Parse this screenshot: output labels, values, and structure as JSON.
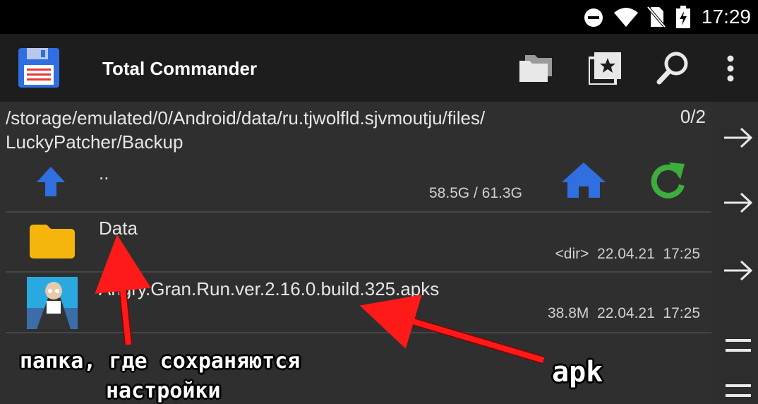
{
  "status_bar": {
    "time": "17:29",
    "icons": [
      "do-not-disturb-icon",
      "wifi-icon",
      "no-sim-icon",
      "battery-charging-icon"
    ]
  },
  "toolbar": {
    "title": "Total Commander",
    "icons": [
      "save-icon",
      "folders-icon",
      "bookmark-icon",
      "search-icon",
      "more-vert-icon"
    ]
  },
  "panel": {
    "path": "/storage/emulated/0/Android/data/ru.tjwolfld.sjvmoutju/files/ LuckyPatcher/Backup",
    "selection_count": "0/2",
    "up_label": "..",
    "free_space": "58.5G / 61.3G",
    "files": [
      {
        "name": "Data",
        "meta": "<dir>  22.04.21  17:25",
        "icon": "folder-icon"
      },
      {
        "name": "Angry.Gran.Run.ver.2.16.0.build.325.apks",
        "meta": "38.8M  22.04.21  17:25",
        "icon": "app-thumbnail"
      }
    ]
  },
  "side_buttons": [
    "copy-arrow-icon",
    "move-arrow-icon",
    "arrow-icon",
    "menu-lines-icon",
    "menu-lines-icon"
  ],
  "annotations": {
    "folder_note_line1": "папка, где сохраняются",
    "folder_note_line2": "настройки",
    "apk_note": "apk"
  },
  "colors": {
    "toolbar_bg": "#1d1d1d",
    "panel_bg": "#2f2f2f",
    "folder": "#f5b50c",
    "blue_icon": "#2f6fe0",
    "refresh": "#3dad3d",
    "arrow_red": "#ff1a1a"
  }
}
